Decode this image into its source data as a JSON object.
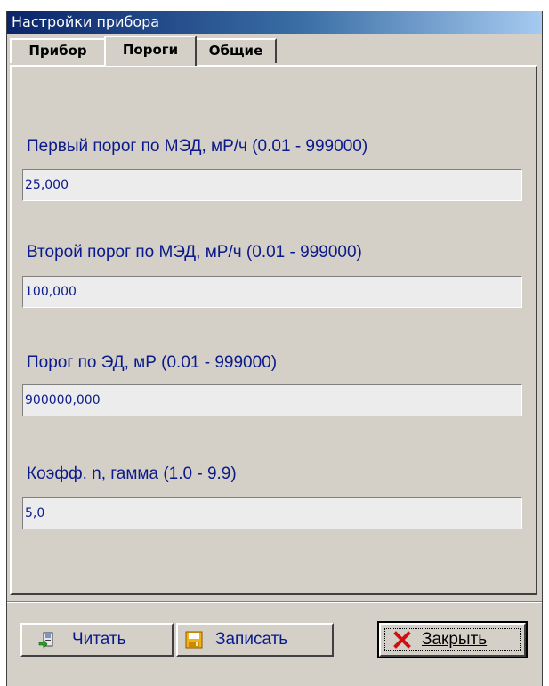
{
  "window": {
    "title": "Настройки прибора"
  },
  "tabs": [
    {
      "label": "Прибор",
      "active": false
    },
    {
      "label": "Пороги",
      "active": true
    },
    {
      "label": "Общие",
      "active": false
    }
  ],
  "fields": [
    {
      "label": "Первый порог по МЭД, мР/ч (0.01 - 999000)",
      "value": "25,000"
    },
    {
      "label": "Второй порог по МЭД, мР/ч (0.01 - 999000)",
      "value": "100,000"
    },
    {
      "label": "Порог по ЭД, мР (0.01 - 999000)",
      "value": "900000,000"
    },
    {
      "label": "Коэфф. n, гамма (1.0 - 9.9)",
      "value": "5,0"
    }
  ],
  "buttons": {
    "read": {
      "label": "Читать",
      "icon": "read-from-device-icon"
    },
    "write": {
      "label": "Записать",
      "icon": "floppy-disk-icon"
    },
    "close": {
      "label": "Закрыть",
      "icon": "red-x-icon"
    }
  },
  "colors": {
    "title_start": "#0a246a",
    "title_end": "#a6caf0",
    "text_blue": "#0a1a8a",
    "face": "#d4d0c8"
  }
}
